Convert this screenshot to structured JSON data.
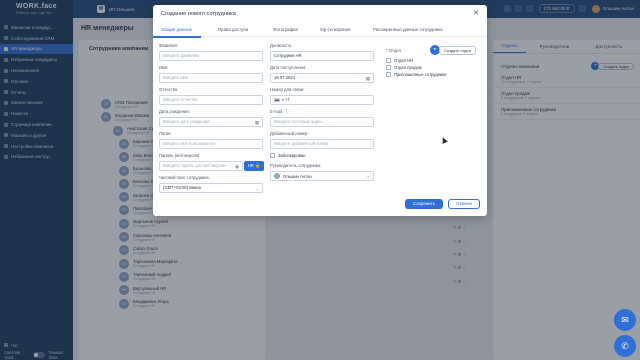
{
  "brand": {
    "name": "WORK.face",
    "tagline": "Работа там, где Вы"
  },
  "sidebar": {
    "items": [
      {
        "label": "Вакансии и кандид..."
      },
      {
        "label": "Собеседования CRM"
      },
      {
        "label": "HR менеджеры",
        "active": true
      },
      {
        "label": "Избранные кандидаты"
      },
      {
        "label": "Напоминания"
      },
      {
        "label": "Отклики"
      },
      {
        "label": "Отчеты"
      },
      {
        "label": "Записи звонков"
      },
      {
        "label": "Новости"
      },
      {
        "label": "Страница компании"
      },
      {
        "label": "Магазин и другое"
      },
      {
        "label": "Настройки компании"
      },
      {
        "label": "Избранные инстру..."
      }
    ],
    "chat": "Чат",
    "theme_left": "Светлая тема",
    "theme_right": "Темная тема"
  },
  "topbar": {
    "company": "ИП Ольшин",
    "phone": "173 962.00 ₽",
    "user": "Ольшин Антон"
  },
  "page": {
    "title": "HR менеджеры",
    "employees_title": "Сотрудники компании",
    "employees": [
      {
        "initials": "CK",
        "name": "CRM Положение",
        "role": "Сотрудник НR"
      },
      {
        "initials": "БЛ",
        "name": "Богданов Максим",
        "role": "Сотрудник НR"
      },
      {
        "initials": "АС",
        "name": "Анастасия Сидорова",
        "role": "Сотрудник НR"
      },
      {
        "initials": "ВА",
        "name": "Баранов Алексей",
        "role": "Сотрудник НR"
      },
      {
        "initials": "ВБ",
        "name": "Вова Белов",
        "role": "Сотрудник НR"
      },
      {
        "initials": "ВА",
        "name": "Базанова Анна",
        "role": "Сотрудник НR"
      },
      {
        "initials": "ВК",
        "name": "Власова Ксения",
        "role": "Сотрудник НR"
      },
      {
        "initials": "ВО",
        "name": "Ветрова Ольга",
        "role": "Сотрудник НR"
      },
      {
        "initials": "ПП",
        "name": "Павлович Полина",
        "role": "Сотрудник НR"
      },
      {
        "initials": "МС",
        "name": "Мартынов Сергей",
        "role": "Сотрудник НR"
      },
      {
        "initials": "СА",
        "name": "Соколова Ангелина",
        "role": "Сотрудник НR"
      },
      {
        "initials": "СО",
        "name": "Сайко Ольга",
        "role": "Сотрудник НR"
      },
      {
        "initials": "ТМ",
        "name": "Тарлонская Маргарита",
        "role": "Сотрудник НR"
      },
      {
        "initials": "ТА",
        "name": "Тарчевский Андрей",
        "role": "Сотрудник НR"
      },
      {
        "initials": "ВН",
        "name": "Виртуальный HR",
        "role": "Сотрудник НR"
      },
      {
        "initials": "БИ",
        "name": "Бондаренко Игорь",
        "role": "Сотрудник НR"
      }
    ],
    "dept_tabs": [
      "Отделы",
      "Руководители",
      "Доступность"
    ],
    "dept_header": "Отделы компании",
    "add_dept": "Создать отдел",
    "depts": [
      {
        "name": "Отдел HR",
        "sub": "10 сотрудников, 0 отделы"
      },
      {
        "name": "Отдел продаж",
        "sub": "0 сотрудников, 0 отделы"
      },
      {
        "name": "Приглашенные сотрудники",
        "sub": "2 сотрудника, 0 отделы"
      }
    ]
  },
  "modal": {
    "title": "Создание нового сотрудника",
    "tabs": [
      "Общие данные",
      "Права доступа",
      "Фотография",
      "Sip-телефония",
      "Расширенные данные сотрудника"
    ],
    "fields": {
      "last_name": {
        "label": "Фамилия:",
        "placeholder": "Введите фамилию"
      },
      "first_name": {
        "label": "Имя:",
        "placeholder": "Введите имя"
      },
      "middle_name": {
        "label": "Отчество:",
        "placeholder": "Введите отчество"
      },
      "birth_date": {
        "label": "Дата рождения:",
        "placeholder": "Введите дату рождения"
      },
      "login": {
        "label": "Логин:",
        "placeholder": "Введите имя пользователя"
      },
      "password": {
        "label": "Пароль (веб-версия):",
        "placeholder": "Введите пароль для веб-версии"
      },
      "timezone": {
        "label": "Часовой пояс сотрудника:",
        "value": "(GMT+03:00) Минск"
      },
      "position": {
        "label": "Должность:",
        "value": "Сотрудник HR"
      },
      "hire_date": {
        "label": "Дата поступления:",
        "value": "19.07.2024"
      },
      "phone": {
        "label": "Номер для связи:",
        "value": "+7"
      },
      "email": {
        "label": "E-mail:",
        "placeholder": "Введите почтовый адрес"
      },
      "extension": {
        "label": "Добавочный номер:",
        "placeholder": "Введите добавочный номер"
      },
      "blocked": {
        "label": "Заблокирован"
      },
      "manager": {
        "label": "Руководитель сотрудника:",
        "value": "Ольшин Антон"
      }
    },
    "key_button": "HR",
    "dept_label": "Отдел",
    "add_dept": "Создать отдел",
    "dept_options": [
      "Отдел HR",
      "Отдел продаж",
      "Приглашенные сотрудники"
    ],
    "save": "Сохранить",
    "cancel": "Отмена"
  }
}
